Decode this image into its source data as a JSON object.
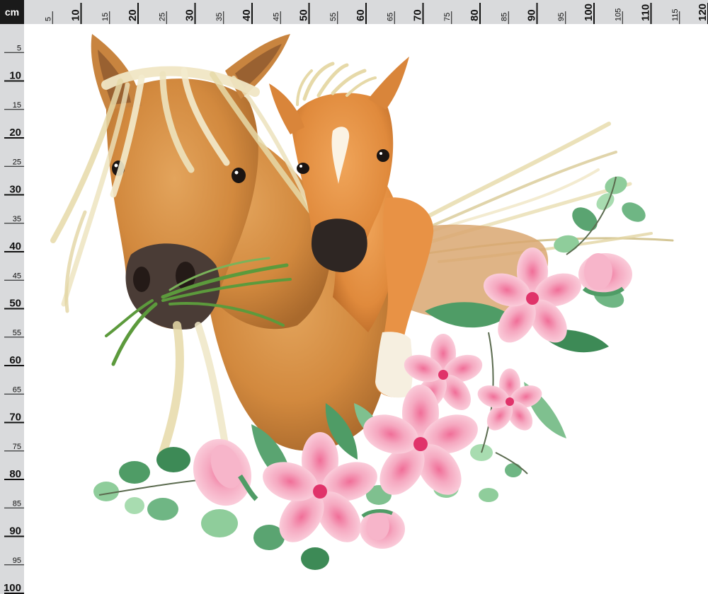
{
  "ruler": {
    "unit": "cm",
    "top_labels": [
      "5",
      "10",
      "15",
      "20",
      "25",
      "30",
      "35",
      "40",
      "45",
      "50",
      "55",
      "60",
      "65",
      "70",
      "75",
      "80",
      "85",
      "90",
      "95",
      "100",
      "105",
      "110",
      "115",
      "120"
    ],
    "left_labels": [
      "5",
      "10",
      "15",
      "20",
      "25",
      "30",
      "35",
      "40",
      "45",
      "50",
      "55",
      "60",
      "65",
      "70",
      "75",
      "80",
      "85",
      "90",
      "95",
      "100"
    ],
    "colors": {
      "ruler_bg": "#d9dadc",
      "tick": "#111111",
      "corner": "#1a1a1a"
    }
  },
  "artwork": {
    "subject": "watercolor mare and foal with pink flowers and eucalyptus leaves",
    "colors": {
      "coat": "#d2893e",
      "coat_dark": "#b06a2a",
      "foal_coat": "#e08a3c",
      "mane": "#e9ddb0",
      "muzzle": "#4a3c36",
      "grass": "#5c9a3c",
      "leaf": "#7fc08f",
      "leaf_dark": "#4f9c66",
      "flower": "#f5a8c0",
      "flower_center": "#e0336a"
    }
  }
}
